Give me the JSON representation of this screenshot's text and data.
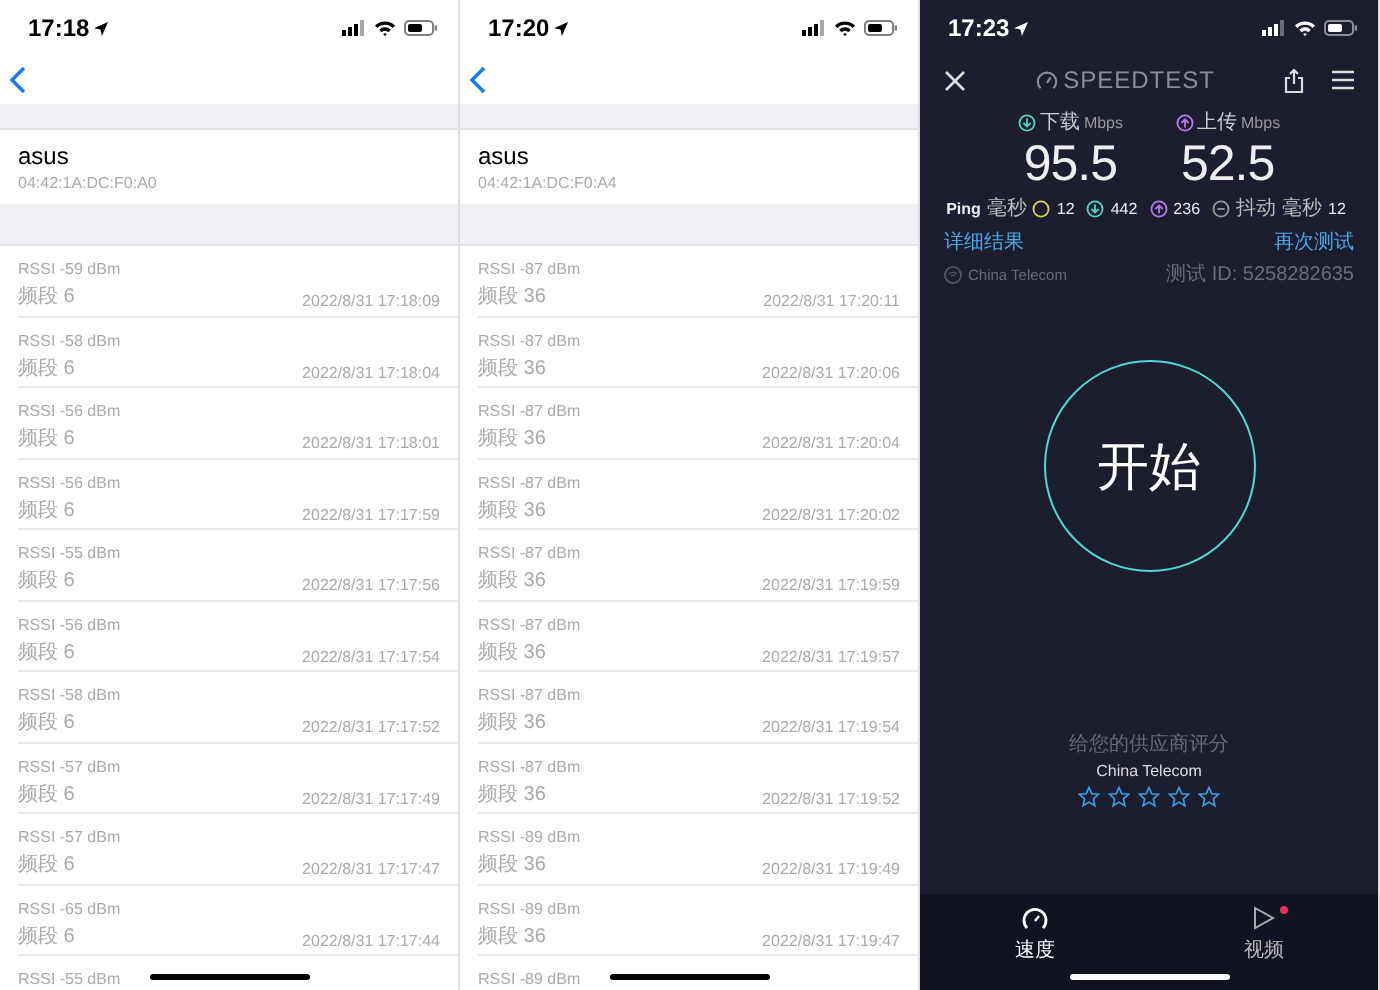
{
  "screens": [
    {
      "kind": "wifi_log",
      "status_time": "17:18",
      "device": {
        "name": "asus",
        "mac": "04:42:1A:DC:F0:A0"
      },
      "records": [
        {
          "rssi": "RSSI -59 dBm",
          "band": "频段 6",
          "time": "2022/8/31 17:18:09"
        },
        {
          "rssi": "RSSI -58 dBm",
          "band": "频段 6",
          "time": "2022/8/31 17:18:04"
        },
        {
          "rssi": "RSSI -56 dBm",
          "band": "频段 6",
          "time": "2022/8/31 17:18:01"
        },
        {
          "rssi": "RSSI -56 dBm",
          "band": "频段 6",
          "time": "2022/8/31 17:17:59"
        },
        {
          "rssi": "RSSI -55 dBm",
          "band": "频段 6",
          "time": "2022/8/31 17:17:56"
        },
        {
          "rssi": "RSSI -56 dBm",
          "band": "频段 6",
          "time": "2022/8/31 17:17:54"
        },
        {
          "rssi": "RSSI -58 dBm",
          "band": "频段 6",
          "time": "2022/8/31 17:17:52"
        },
        {
          "rssi": "RSSI -57 dBm",
          "band": "频段 6",
          "time": "2022/8/31 17:17:49"
        },
        {
          "rssi": "RSSI -57 dBm",
          "band": "频段 6",
          "time": "2022/8/31 17:17:47"
        },
        {
          "rssi": "RSSI -65 dBm",
          "band": "频段 6",
          "time": "2022/8/31 17:17:44"
        },
        {
          "rssi": "RSSI -55 dBm"
        }
      ]
    },
    {
      "kind": "wifi_log",
      "status_time": "17:20",
      "device": {
        "name": "asus",
        "mac": "04:42:1A:DC:F0:A4"
      },
      "records": [
        {
          "rssi": "RSSI -87 dBm",
          "band": "频段 36",
          "time": "2022/8/31 17:20:11"
        },
        {
          "rssi": "RSSI -87 dBm",
          "band": "频段 36",
          "time": "2022/8/31 17:20:06"
        },
        {
          "rssi": "RSSI -87 dBm",
          "band": "频段 36",
          "time": "2022/8/31 17:20:04"
        },
        {
          "rssi": "RSSI -87 dBm",
          "band": "频段 36",
          "time": "2022/8/31 17:20:02"
        },
        {
          "rssi": "RSSI -87 dBm",
          "band": "频段 36",
          "time": "2022/8/31 17:19:59"
        },
        {
          "rssi": "RSSI -87 dBm",
          "band": "频段 36",
          "time": "2022/8/31 17:19:57"
        },
        {
          "rssi": "RSSI -87 dBm",
          "band": "频段 36",
          "time": "2022/8/31 17:19:54"
        },
        {
          "rssi": "RSSI -87 dBm",
          "band": "频段 36",
          "time": "2022/8/31 17:19:52"
        },
        {
          "rssi": "RSSI -89 dBm",
          "band": "频段 36",
          "time": "2022/8/31 17:19:49"
        },
        {
          "rssi": "RSSI -89 dBm",
          "band": "频段 36",
          "time": "2022/8/31 17:19:47"
        },
        {
          "rssi": "RSSI -89 dBm"
        }
      ]
    },
    {
      "kind": "speedtest",
      "status_time": "17:23",
      "logo": "SPEEDTEST",
      "download": {
        "label": "下载",
        "unit": "Mbps",
        "value": "95.5"
      },
      "upload": {
        "label": "上传",
        "unit": "Mbps",
        "value": "52.5"
      },
      "ping": {
        "label": "Ping",
        "unit": "毫秒",
        "idle": "12",
        "down": "442",
        "up": "236",
        "jitter_label": "抖动",
        "jitter_unit": "毫秒",
        "jitter": "12"
      },
      "links": [
        "详细结果",
        "再次测试"
      ],
      "provider": "China Telecom",
      "test_id": "测试 ID: 5258282635",
      "start": "开始",
      "rating": {
        "prompt": "给您的供应商评分",
        "provider": "China Telecom",
        "stars": 0
      },
      "tabs": [
        {
          "label": "速度",
          "selected": true,
          "notification": false
        },
        {
          "label": "视频",
          "selected": false,
          "notification": true
        }
      ]
    }
  ]
}
